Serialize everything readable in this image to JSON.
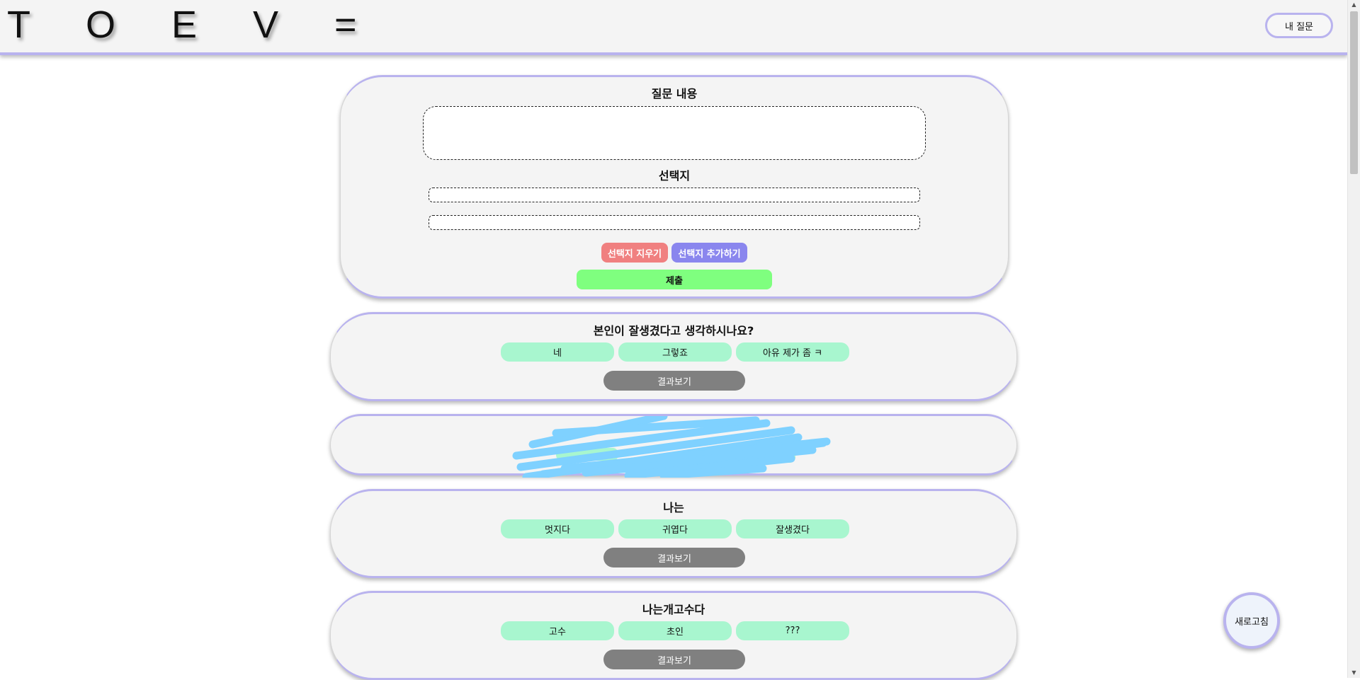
{
  "header": {
    "logo": "T O E V =",
    "my_questions_label": "내 질문"
  },
  "form": {
    "title": "질문 내용",
    "choices_title": "선택지",
    "question_value": "",
    "choice_values": [
      "",
      ""
    ],
    "remove_choice_label": "선택지 지우기",
    "add_choice_label": "선택지 추가하기",
    "submit_label": "제출"
  },
  "questions": [
    {
      "title": "본인이 잘생겼다고 생각하시나요?",
      "options": [
        "네",
        "그렇죠",
        "아유 제가 좀 ㅋ"
      ],
      "result_label": "결과보기"
    },
    {
      "title": "나는",
      "options": [
        "멋지다",
        "귀엽다",
        "잘생겼다"
      ],
      "result_label": "결과보기"
    },
    {
      "title": "나는개고수다",
      "options": [
        "고수",
        "초인",
        "???"
      ],
      "result_label": "결과보기"
    }
  ],
  "colors": {
    "accent_border": "#b9b3ee",
    "option_bg": "#a8f6cf",
    "result_bg": "#808080",
    "remove_bg": "#f08080",
    "add_bg": "#8a86ee",
    "submit_bg": "#7fff7f",
    "scribble": "#7fd1ff"
  },
  "refresh_label": "새로고침"
}
